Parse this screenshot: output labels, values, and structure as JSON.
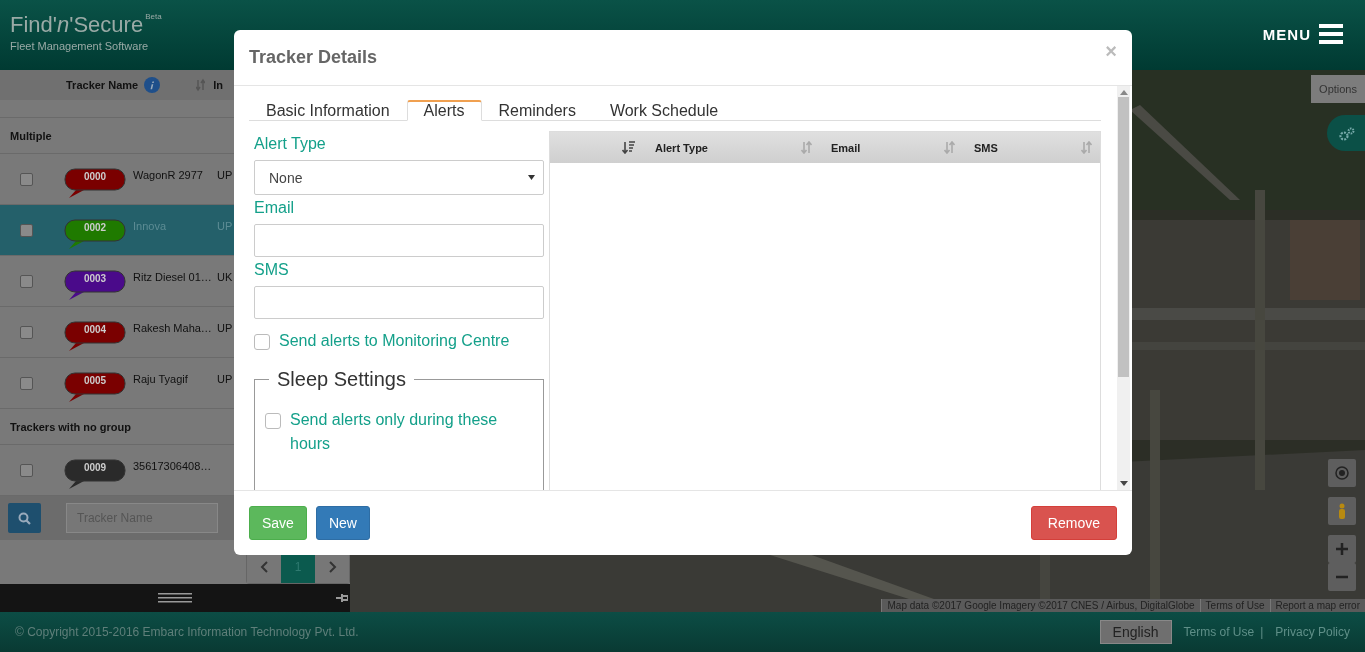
{
  "header": {
    "logo": "Find'*n*'Secure",
    "logo_badge": "Beta",
    "tagline": "Fleet Management Software",
    "menu": "MENU"
  },
  "tracker_list": {
    "columns": [
      "Tracker Name",
      "In"
    ],
    "groups": [
      {
        "name": "Multiple",
        "trackers": [
          {
            "id": "0000",
            "color": "#7a0000",
            "name": "WagonR 2977",
            "plate": "UP",
            "selected": false,
            "checked": false
          },
          {
            "id": "0002",
            "color": "#1f7a00",
            "name": "Innova",
            "plate": "UP",
            "selected": true,
            "checked": false
          },
          {
            "id": "0003",
            "color": "#4a0a8a",
            "name": "Ritz Diesel 01…",
            "plate": "UK",
            "selected": false,
            "checked": false
          },
          {
            "id": "0004",
            "color": "#7a0000",
            "name": "Rakesh Maha…",
            "plate": "UP",
            "selected": false,
            "checked": false
          },
          {
            "id": "0005",
            "color": "#7a0000",
            "name": "Raju Tyagif",
            "plate": "UP",
            "selected": false,
            "checked": false
          }
        ]
      },
      {
        "name": "Trackers with no group",
        "trackers": [
          {
            "id": "0009",
            "color": "#2a2a2a",
            "name": "35617306408…",
            "selected": false,
            "checked": false
          }
        ]
      }
    ],
    "search_placeholder": "Tracker Name",
    "pages": [
      {
        "label": "1",
        "selected": true
      }
    ]
  },
  "map": {
    "options": "Options",
    "attribution": "Map data ©2017 Google Imagery ©2017 CNES / Airbus, DigitalGlobe",
    "links": [
      "Terms of Use",
      "Report a map error"
    ]
  },
  "footer": {
    "copyright": "© Copyright 2015-2016 Embarc Information Technology Pvt. Ltd.",
    "language": "English",
    "links": [
      "Terms of Use",
      "Privacy Policy"
    ],
    "separator": "|"
  },
  "modal": {
    "title": "Tracker Details",
    "close": "×",
    "tabs": [
      {
        "label": "Basic Information",
        "selected": false
      },
      {
        "label": "Alerts",
        "selected": true
      },
      {
        "label": "Reminders",
        "selected": false
      },
      {
        "label": "Work Schedule",
        "selected": false
      }
    ],
    "form": {
      "alert_type_label": "Alert Type",
      "alert_type_value": "None",
      "email_label": "Email",
      "sms_label": "SMS",
      "monitoring": {
        "label": "Send alerts to Monitoring Centre",
        "checked": false
      },
      "sleep_legend": "Sleep Settings",
      "sleep_only": {
        "label": "Send alerts only during these hours",
        "checked": false
      }
    },
    "table": {
      "columns": [
        "Alert Type",
        "Email",
        "SMS"
      ]
    },
    "buttons": [
      {
        "label": "Save",
        "kind": "success"
      },
      {
        "label": "New",
        "kind": "primary"
      },
      {
        "label": "Remove",
        "kind": "danger"
      }
    ]
  }
}
